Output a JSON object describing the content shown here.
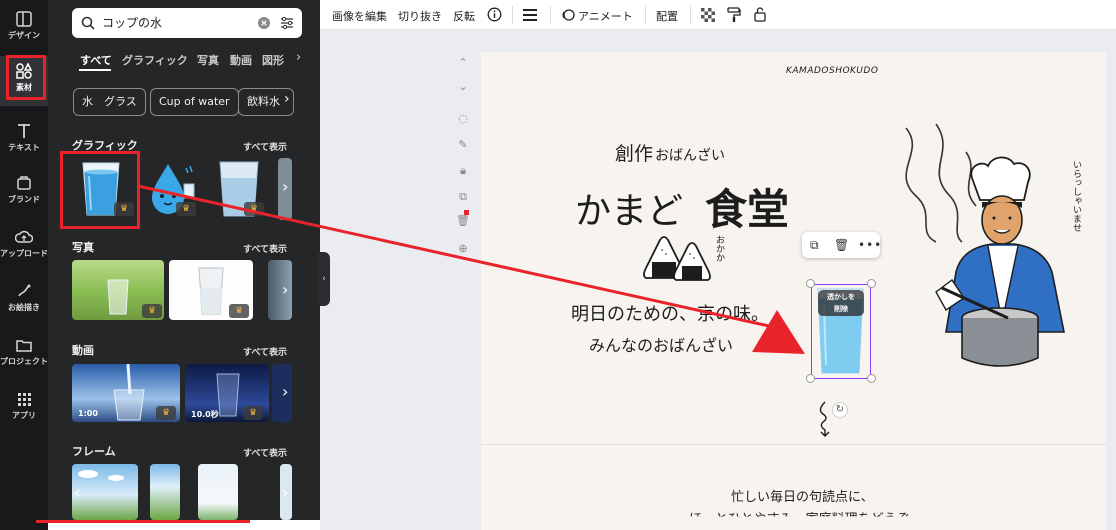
{
  "rail": {
    "items": [
      {
        "label": "デザイン",
        "icon": "layout-icon"
      },
      {
        "label": "素材",
        "icon": "shapes-icon"
      },
      {
        "label": "テキスト",
        "icon": "text-icon"
      },
      {
        "label": "ブランド",
        "icon": "brand-icon"
      },
      {
        "label": "アップロード",
        "icon": "upload-cloud-icon"
      },
      {
        "label": "お絵描き",
        "icon": "draw-icon"
      },
      {
        "label": "プロジェクト",
        "icon": "folder-icon"
      },
      {
        "label": "アプリ",
        "icon": "apps-grid-icon"
      }
    ]
  },
  "panel": {
    "search": {
      "value": "コップの水",
      "placeholder": ""
    },
    "tabs": [
      "すべて",
      "グラフィック",
      "写真",
      "動画",
      "図形"
    ],
    "chips": [
      "水　グラス",
      "Cup of water",
      "飲料水"
    ],
    "sections": {
      "graphics": {
        "title": "グラフィック",
        "see_all": "すべて表示"
      },
      "photos": {
        "title": "写真",
        "see_all": "すべて表示"
      },
      "videos": {
        "title": "動画",
        "see_all": "すべて表示",
        "durations": [
          "1:00",
          "10.0秒"
        ]
      },
      "frames": {
        "title": "フレーム",
        "see_all": "すべて表示"
      }
    }
  },
  "toolbar": {
    "edit_image": "画像を編集",
    "crop": "切り抜き",
    "flip": "反転",
    "animate": "アニメート",
    "position": "配置"
  },
  "page": {
    "brand": "KAMADOSHOKUDO",
    "subtitle_kanji": "創作",
    "subtitle_kana": "おばんざい",
    "title_kana": "かまど",
    "title_kanji": "食堂",
    "okazu": "おかか",
    "line1": "明日のための、京の味。",
    "line2": "みんなのおばんざい",
    "irasshaimase": "いらっしゃいませ",
    "bottom_line": "忙しい毎日の句読点に、",
    "bottom_line2": "ほっとひとやすみ。家庭料理をどうぞ",
    "watermark_label_1": "透かしを",
    "watermark_label_2": "削除"
  },
  "colors": {
    "accent_red": "#e8242a",
    "selection_purple": "#8b3dff",
    "panel_bg": "#252627",
    "rail_bg": "#18191b",
    "page_bg": "#f7f4ef"
  }
}
